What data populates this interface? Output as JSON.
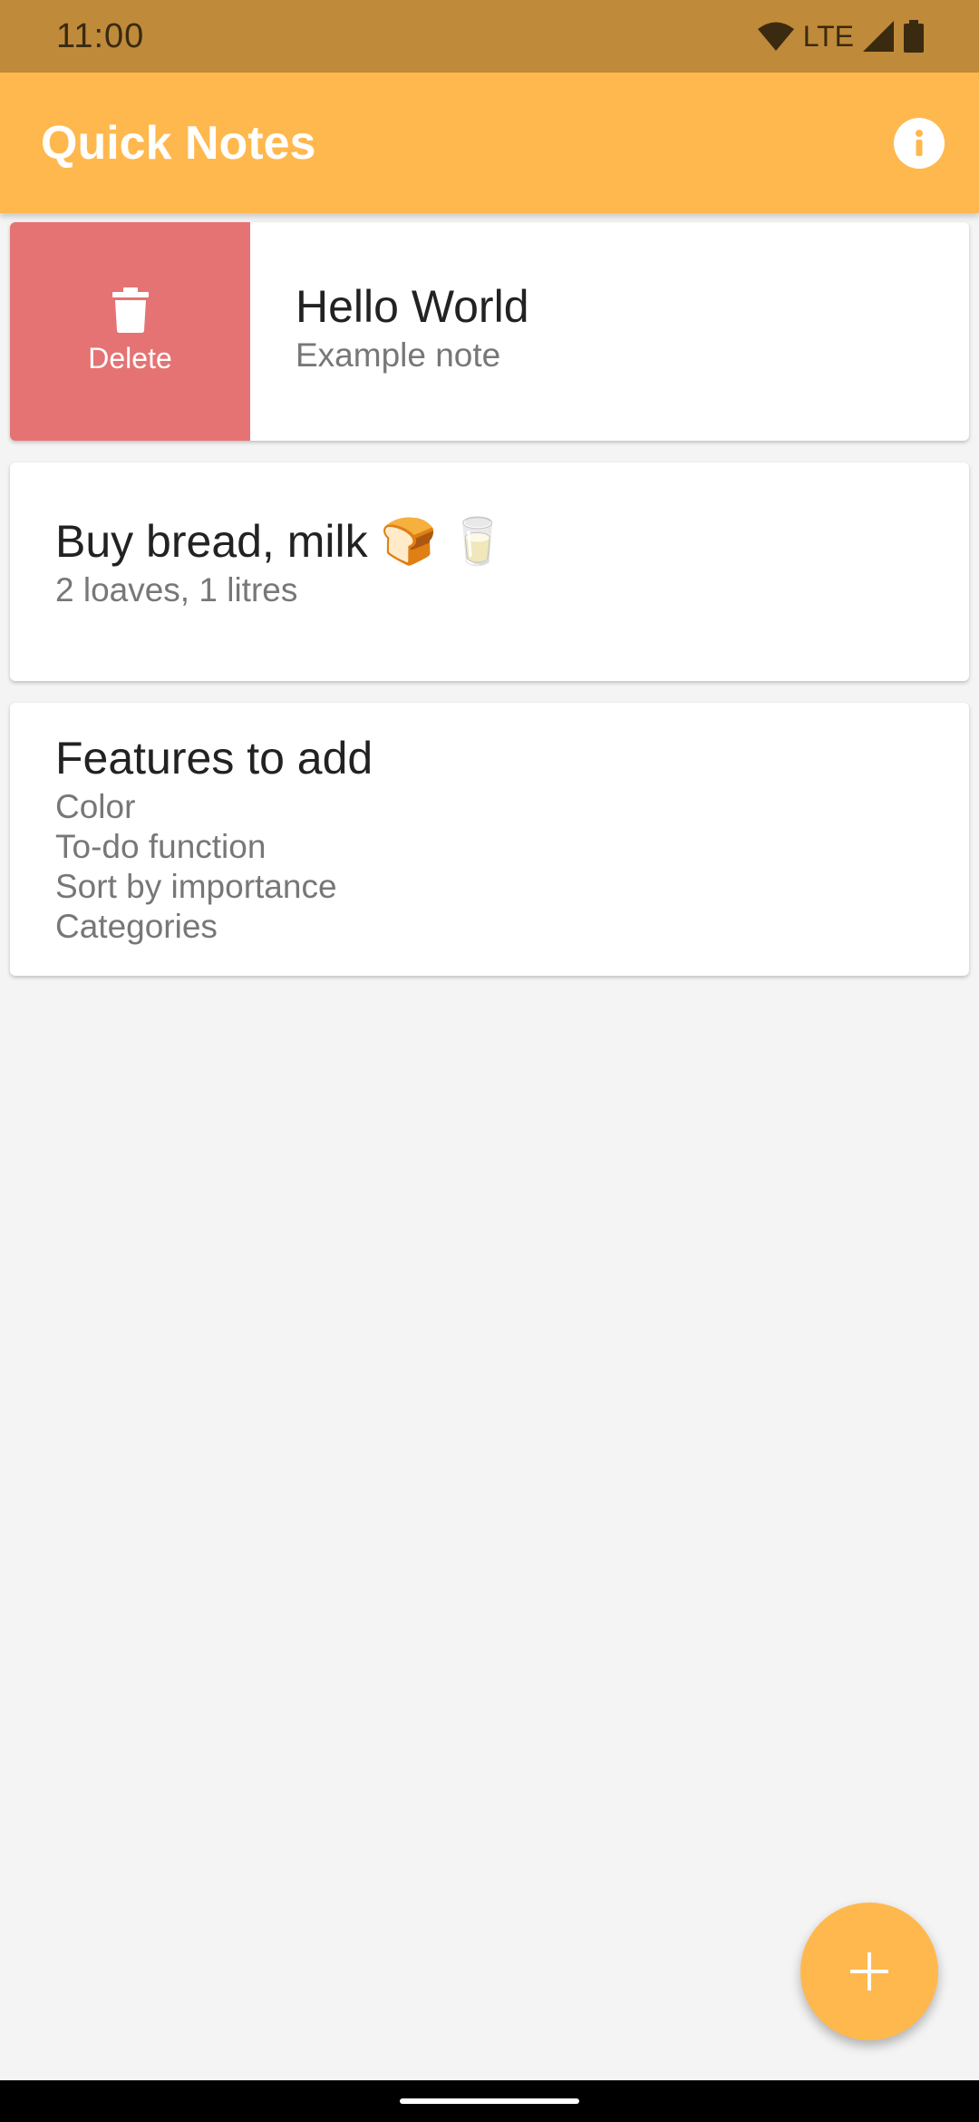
{
  "status_bar": {
    "time": "11:00",
    "network": "LTE"
  },
  "app_bar": {
    "title": "Quick Notes",
    "info_icon": "info-icon"
  },
  "notes": [
    {
      "title": "Hello World",
      "body": "Example note",
      "swipe_action": {
        "label": "Delete",
        "icon": "trash-icon",
        "color": "#e57373"
      }
    },
    {
      "title": "Buy bread, milk 🍞 🥛",
      "body": "2 loaves, 1 litres"
    },
    {
      "title": "Features to add",
      "body_lines": [
        "Color",
        "To-do function",
        "Sort by importance",
        "Categories"
      ]
    }
  ],
  "fab": {
    "icon": "plus-icon"
  },
  "colors": {
    "accent": "#ffb84d",
    "status_bar": "#bf8a3a",
    "delete": "#e57373",
    "background": "#f4f4f4"
  }
}
